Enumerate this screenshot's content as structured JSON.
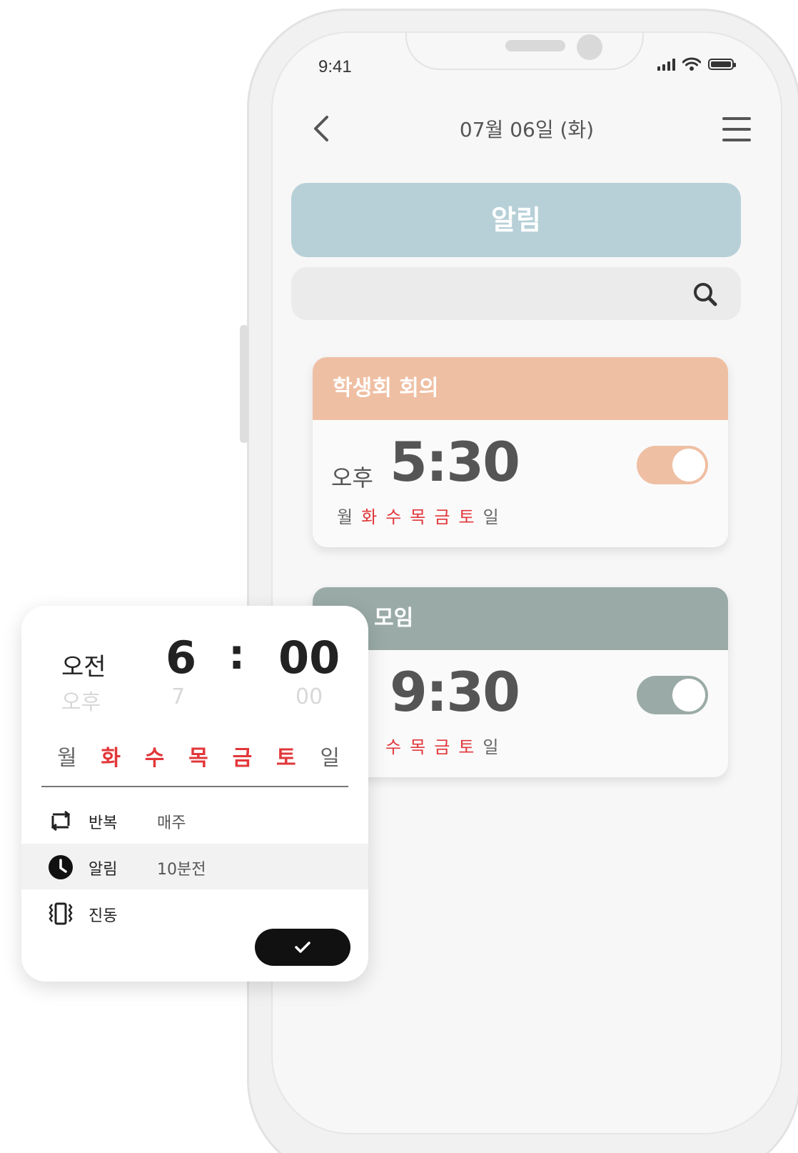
{
  "status_bar": {
    "time": "9:41"
  },
  "header": {
    "date": "07월 06일 (화)"
  },
  "title": "알림",
  "alarms": [
    {
      "title": "학생회 회의",
      "ampm": "오후",
      "time": "5:30",
      "enabled": true,
      "color": "#efbfa3",
      "days": [
        {
          "label": "월",
          "active": false
        },
        {
          "label": "화",
          "active": true
        },
        {
          "label": "수",
          "active": true
        },
        {
          "label": "목",
          "active": true
        },
        {
          "label": "금",
          "active": true
        },
        {
          "label": "토",
          "active": true
        },
        {
          "label": "일",
          "active": false
        }
      ]
    },
    {
      "title": "모임",
      "time": "9:30",
      "enabled": true,
      "color": "#9aaba7",
      "days": [
        {
          "label": "수",
          "active": true
        },
        {
          "label": "목",
          "active": true
        },
        {
          "label": "금",
          "active": true
        },
        {
          "label": "토",
          "active": true
        },
        {
          "label": "일",
          "active": false
        }
      ]
    }
  ],
  "picker": {
    "ampm_selected": "오전",
    "ampm_next": "오후",
    "hour_selected": "6",
    "hour_next": "7",
    "colon": ":",
    "minute_selected": "00",
    "minute_next": "00",
    "days": [
      {
        "label": "월",
        "active": false
      },
      {
        "label": "화",
        "active": true
      },
      {
        "label": "수",
        "active": true
      },
      {
        "label": "목",
        "active": true
      },
      {
        "label": "금",
        "active": true
      },
      {
        "label": "토",
        "active": true
      },
      {
        "label": "일",
        "active": false
      }
    ],
    "options": [
      {
        "icon": "repeat-icon",
        "label": "반복",
        "value": "매주"
      },
      {
        "icon": "clock-icon",
        "label": "알림",
        "value": "10분전"
      },
      {
        "icon": "vibrate-icon",
        "label": "진동",
        "value": ""
      }
    ],
    "confirm_icon": "check-icon"
  },
  "colors": {
    "banner": "#b7d0d8",
    "day_active": "#e2373a",
    "day_inactive": "#666666",
    "card1_accent": "#efbfa3",
    "card2_accent": "#9aaba7",
    "confirm": "#111111"
  }
}
